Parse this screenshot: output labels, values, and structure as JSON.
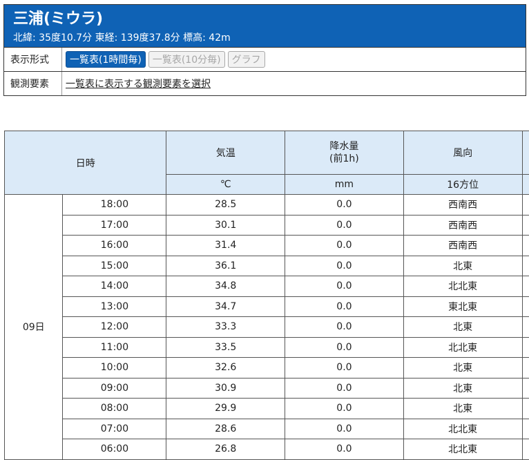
{
  "station": {
    "title": "三浦(ミウラ)",
    "coords": "北緯: 35度10.7分 東経: 139度37.8分 標高: 42m"
  },
  "options": {
    "display_format_label": "表示形式",
    "buttons": [
      {
        "label": "一覧表(1時間毎)",
        "active": true
      },
      {
        "label": "一覧表(10分毎)",
        "active": false
      },
      {
        "label": "グラフ",
        "active": false
      }
    ],
    "elements_label": "観測要素",
    "elements_link": "一覧表に表示する観測要素を選択"
  },
  "table": {
    "headers": {
      "datetime": "日時",
      "temp": "気温",
      "precip_line1": "降水量",
      "precip_line2": "(前1h)",
      "wind_dir": "風向"
    },
    "units": {
      "temp": "℃",
      "precip": "mm",
      "wind_dir": "16方位"
    },
    "day": "09日",
    "rows": [
      {
        "time": "18:00",
        "temp": "28.5",
        "precip": "0.0",
        "wind": "西南西"
      },
      {
        "time": "17:00",
        "temp": "30.1",
        "precip": "0.0",
        "wind": "西南西"
      },
      {
        "time": "16:00",
        "temp": "31.4",
        "precip": "0.0",
        "wind": "西南西"
      },
      {
        "time": "15:00",
        "temp": "36.1",
        "precip": "0.0",
        "wind": "北東"
      },
      {
        "time": "14:00",
        "temp": "34.8",
        "precip": "0.0",
        "wind": "北北東"
      },
      {
        "time": "13:00",
        "temp": "34.7",
        "precip": "0.0",
        "wind": "東北東"
      },
      {
        "time": "12:00",
        "temp": "33.3",
        "precip": "0.0",
        "wind": "北東"
      },
      {
        "time": "11:00",
        "temp": "33.5",
        "precip": "0.0",
        "wind": "北北東"
      },
      {
        "time": "10:00",
        "temp": "32.6",
        "precip": "0.0",
        "wind": "北東"
      },
      {
        "time": "09:00",
        "temp": "30.9",
        "precip": "0.0",
        "wind": "北東"
      },
      {
        "time": "08:00",
        "temp": "29.9",
        "precip": "0.0",
        "wind": "北東"
      },
      {
        "time": "07:00",
        "temp": "28.6",
        "precip": "0.0",
        "wind": "北北東"
      },
      {
        "time": "06:00",
        "temp": "26.8",
        "precip": "0.0",
        "wind": "北北東"
      }
    ]
  }
}
